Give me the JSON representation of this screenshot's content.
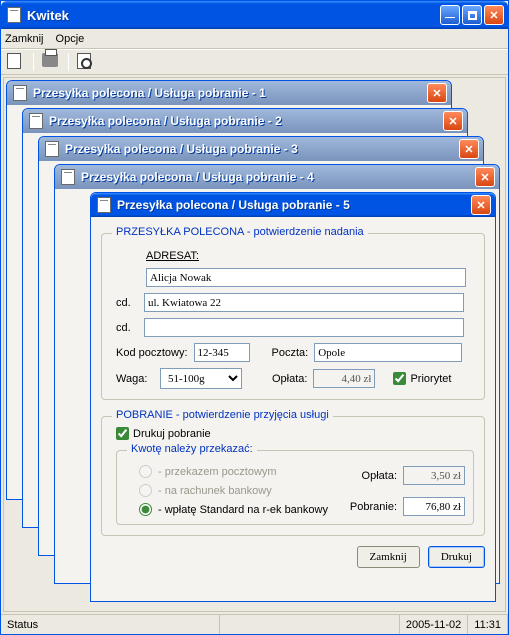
{
  "app": {
    "title": "Kwitek"
  },
  "menu": {
    "close": "Zamknij",
    "options": "Opcje"
  },
  "stacked_titles": [
    "Przesyłka polecona / Usługa pobranie - 1",
    "Przesyłka polecona / Usługa pobranie - 2",
    "Przesyłka polecona / Usługa pobranie - 3",
    "Przesyłka polecona / Usługa pobranie - 4"
  ],
  "active": {
    "title": "Przesyłka polecona / Usługa pobranie - 5",
    "section1": {
      "legend_main": "PRZESYŁKA POLECONA",
      "legend_sub": " - potwierdzenie nadania",
      "adresat_label": "ADRESAT:",
      "name": "Alicja Nowak",
      "cd_label": "cd.",
      "addr1": "ul. Kwiatowa 22",
      "addr2": "",
      "postcode_label": "Kod pocztowy:",
      "postcode": "12-345",
      "city_label": "Poczta:",
      "city": "Opole",
      "weight_label": "Waga:",
      "weight_value": "51-100g",
      "fee_label": "Opłata:",
      "fee_value": "4,40 zł",
      "priority_label": "Priorytet",
      "priority_checked": true
    },
    "section2": {
      "legend_main": "POBRANIE",
      "legend_sub": " - potwierdzenie przyjęcia usługi",
      "print_label": "Drukuj pobranie",
      "print_checked": true,
      "transfer_legend": "Kwotę należy przekazać:",
      "opt1": "- przekazem pocztowym",
      "opt2": "- na rachunek bankowy",
      "opt3": "- wpłatę Standard na r-ek bankowy",
      "fee_label": "Opłata:",
      "fee_value": "3,50 zł",
      "cod_label": "Pobranie:",
      "cod_value": "76,80 zł"
    },
    "buttons": {
      "close": "Zamknij",
      "print": "Drukuj"
    }
  },
  "status": {
    "text": "Status",
    "date": "2005-11-02",
    "time": "11:31"
  }
}
